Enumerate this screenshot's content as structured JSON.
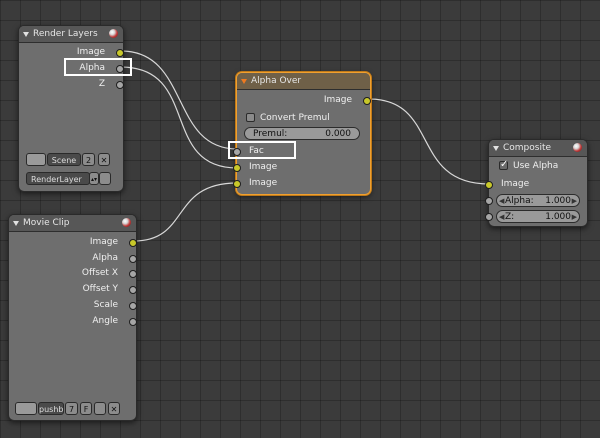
{
  "nodes": {
    "render_layers": {
      "title": "Render Layers",
      "outputs": [
        "Image",
        "Alpha",
        "Z"
      ],
      "scene_label": "Scene",
      "scene_users": "2",
      "layer_value": "RenderLayer"
    },
    "movie_clip": {
      "title": "Movie Clip",
      "outputs": [
        "Image",
        "Alpha",
        "Offset X",
        "Offset Y",
        "Scale",
        "Angle"
      ],
      "clip_name": "pushb",
      "clip_users": "7",
      "fake_user": "F"
    },
    "alpha_over": {
      "title": "Alpha Over",
      "output": "Image",
      "convert_premul_label": "Convert Premul",
      "premul_label": "Premul:",
      "premul_value": "0.000",
      "inputs": [
        "Fac",
        "Image",
        "Image"
      ]
    },
    "composite": {
      "title": "Composite",
      "use_alpha_label": "Use Alpha",
      "use_alpha_checked": true,
      "input": "Image",
      "alpha_label": "Alpha:",
      "alpha_value": "1.000",
      "z_label": "Z:",
      "z_value": "1.000"
    }
  },
  "highlights": [
    "Alpha output of Render Layers",
    "Fac input of Alpha Over"
  ],
  "colors": {
    "background": "#3b3b3b",
    "node_body": "#6e6e6e",
    "active_outline": "#f0a030",
    "socket_color": "#c8c82a",
    "socket_value": "#a6a6a6"
  }
}
